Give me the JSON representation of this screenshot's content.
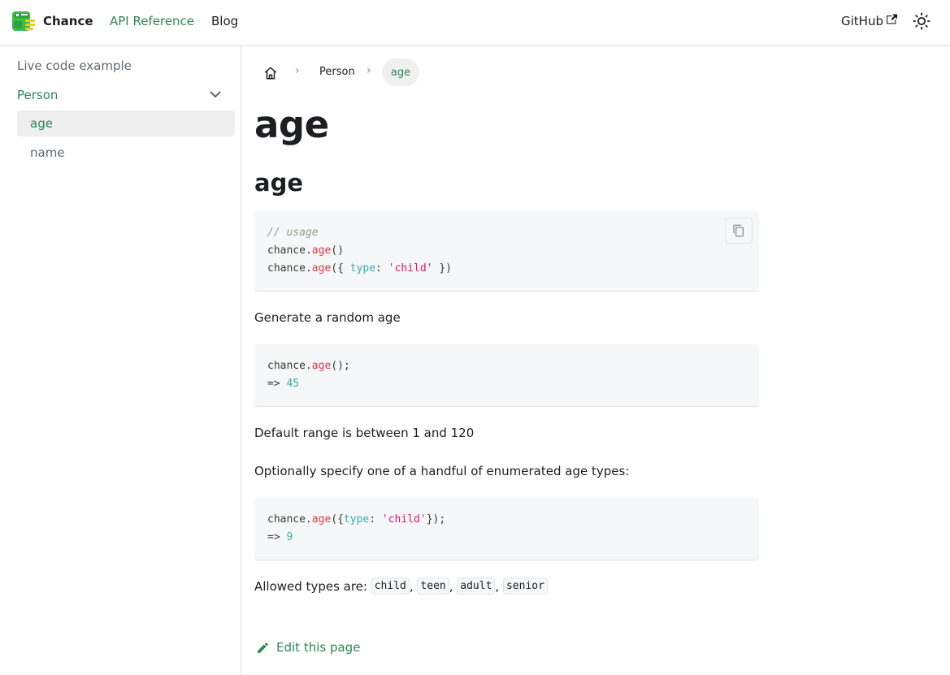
{
  "navbar": {
    "brand": "Chance",
    "api_reference": "API Reference",
    "blog": "Blog",
    "github": "GitHub"
  },
  "sidebar": {
    "items": [
      {
        "label": "Live code example"
      },
      {
        "label": "Person"
      },
      {
        "label": "age"
      },
      {
        "label": "name"
      }
    ]
  },
  "breadcrumbs": {
    "parent": "Person",
    "current": "age"
  },
  "page": {
    "title": "age",
    "subtitle": "age",
    "code1": {
      "comment": "// usage",
      "obj": "chance",
      "fn": "age",
      "prop": "type",
      "str": "'child'"
    },
    "p1": "Generate a random age",
    "code2": {
      "result": "45"
    },
    "p2": "Default range is between 1 and 120",
    "p3": "Optionally specify one of a handful of enumerated age types:",
    "code3": {
      "result": "9"
    },
    "allowed_prefix": "Allowed types are: ",
    "allowed_types": [
      "child",
      "teen",
      "adult",
      "senior"
    ],
    "edit_link": "Edit this page"
  },
  "colors": {
    "primary": "#2e8555",
    "code_bg": "#f6f7f8",
    "text": "#1c1e21"
  }
}
